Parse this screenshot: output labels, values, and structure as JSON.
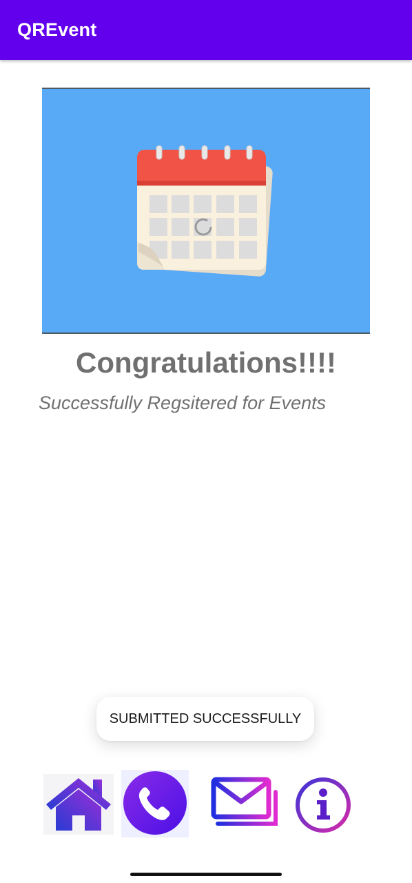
{
  "app": {
    "title": "QREvent"
  },
  "main": {
    "headline": "Congratulations!!!!",
    "subline": "Successfully Regsitered for Events"
  },
  "toast": {
    "message": "SUBMITTED SUCCESSFULLY"
  },
  "nav": {
    "items": [
      {
        "icon": "home-icon"
      },
      {
        "icon": "phone-icon"
      },
      {
        "icon": "mail-icon"
      },
      {
        "icon": "info-icon"
      }
    ]
  },
  "colors": {
    "app_bar": "#6200ee",
    "banner_bg": "#58aaf7",
    "text_gray": "#707070"
  }
}
